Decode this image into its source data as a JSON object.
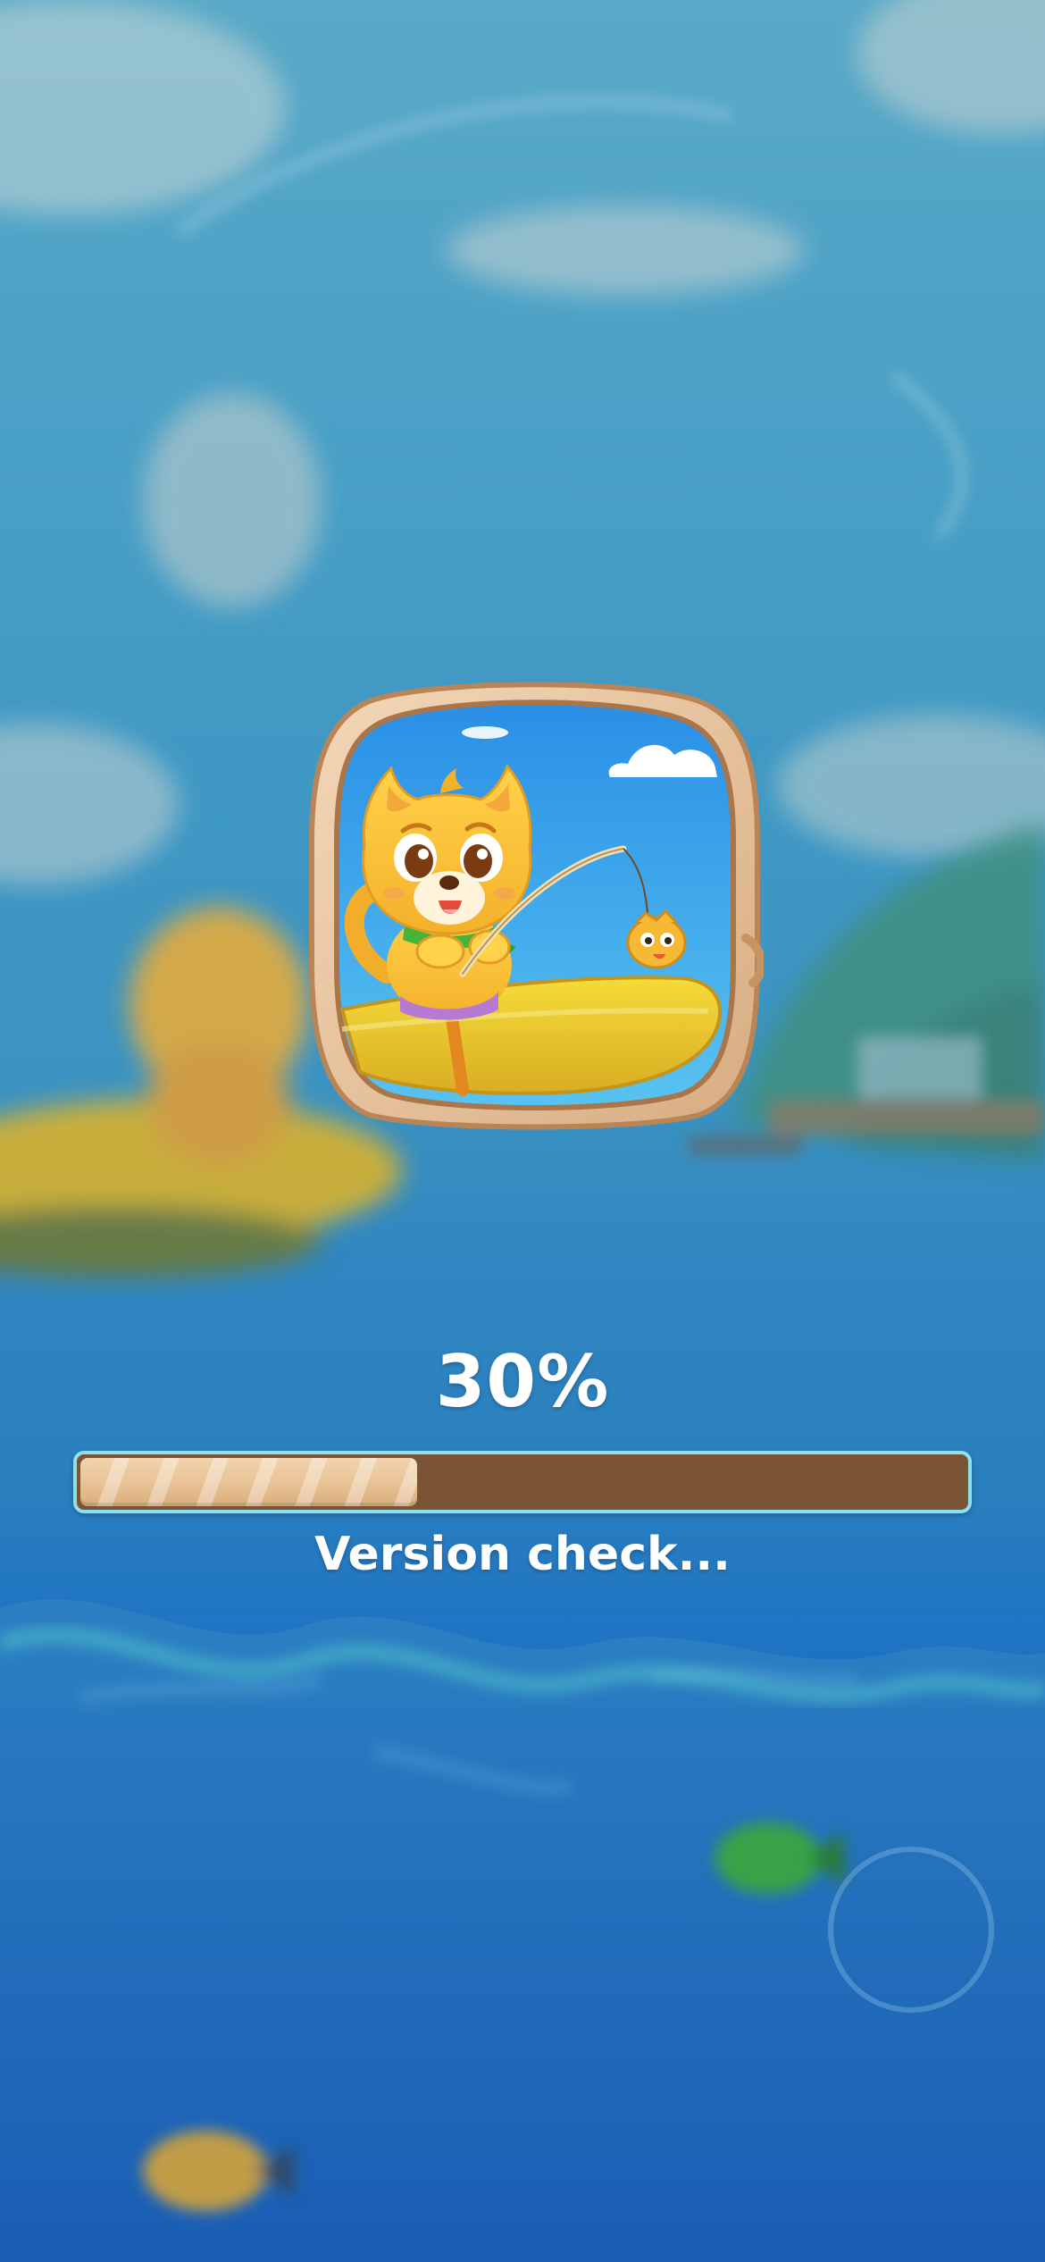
{
  "loading": {
    "progress_percent": 30,
    "progress_label": "30%",
    "status_text": "Version check..."
  },
  "colors": {
    "progress_track": "#7a5434",
    "progress_fill": "#e8c294",
    "progress_border": "#8fe0ee",
    "text": "#ffffff"
  },
  "icons": {
    "logo": "cat-fishing-in-boat-icon",
    "background": "blurred-lake-scene"
  }
}
